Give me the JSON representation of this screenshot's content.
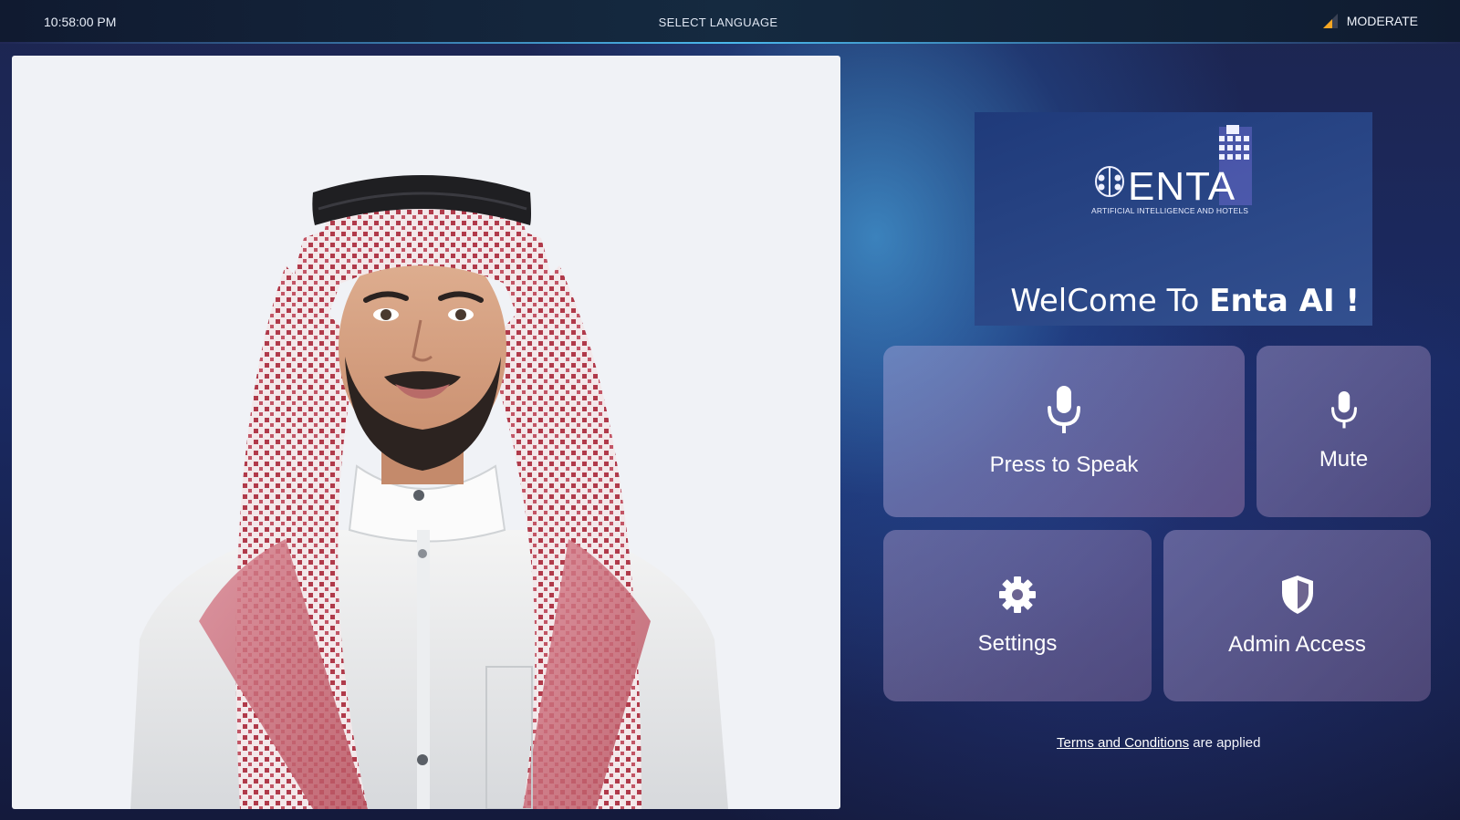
{
  "topbar": {
    "time": "10:58:00 PM",
    "language_label": "SELECT LANGUAGE",
    "connection_label": "MODERATE",
    "connection_color": "#f5a623",
    "connection_icon": "signal-icon"
  },
  "avatar": {
    "icon": "avatar-portrait"
  },
  "brand": {
    "logo_text": "ENTA",
    "logo_subtitle": "ARTIFICIAL INTELLIGENCE AND HOTELS",
    "welcome_prefix": "WelCome To ",
    "welcome_name": "Enta AI !"
  },
  "actions": {
    "speak_label": "Press to Speak",
    "speak_icon": "microphone-icon",
    "mute_label": "Mute",
    "mute_icon": "microphone-icon",
    "settings_label": "Settings",
    "settings_icon": "gear-icon",
    "admin_label": "Admin Access",
    "admin_icon": "shield-icon"
  },
  "footer": {
    "terms_link": "Terms and Conditions",
    "terms_suffix": " are applied"
  }
}
